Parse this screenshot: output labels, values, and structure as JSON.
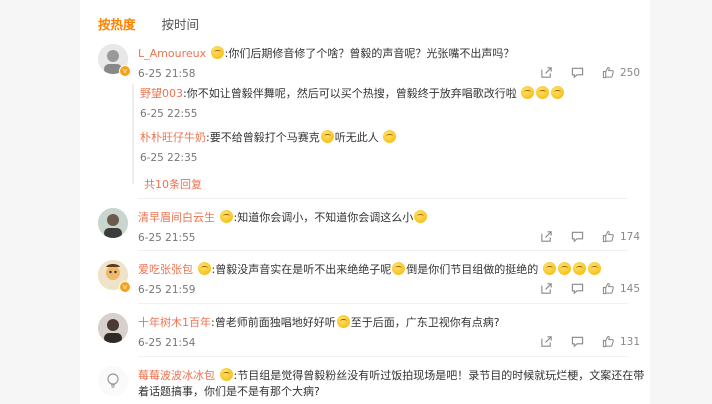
{
  "tabs": [
    {
      "label": "按热度"
    },
    {
      "label": "按时间"
    }
  ],
  "comments": [
    {
      "user": "L_Amoureux",
      "text": ":你们后期修音修了个啥？曾毅的声音呢？光张嘴不出声吗？",
      "time": "6-25 21:58",
      "likes": "250",
      "replies": [
        {
          "user": "野望003",
          "text": ":你不如让曾毅伴舞呢，然后可以买个热搜，曾毅终于放弃唱歌改行啦",
          "time": "6-25 22:55"
        },
        {
          "user": "朴朴旺仔牛奶",
          "text": ":要不给曾毅打个马赛克",
          "text2": "听无此人",
          "time": "6-25 22:35"
        }
      ],
      "more_replies": "共10条回复"
    },
    {
      "user": "清早眉间白云生",
      "text": ":知道你会调小，不知道你会调这么小",
      "time": "6-25 21:55",
      "likes": "174"
    },
    {
      "user": "爱吃张张包",
      "text": ":曾毅没声音实在是听不出来绝绝子呢",
      "text2": "倒是你们节目组做的挺绝的",
      "time": "6-25 21:59",
      "likes": "145"
    },
    {
      "user": "十年树木1百年",
      "text": ":曾老师前面独唱地好好听",
      "text2": "至于后面，广东卫视你有点病?",
      "time": "6-25 21:54",
      "likes": "131"
    },
    {
      "user": "莓莓波波冰冰包",
      "text": ":节目组是觉得曾毅粉丝没有听过饭拍现场是吧！录节目的时候就玩烂梗，文案还在带",
      "text2": "着话题搞事，你们是不是有那个大病?"
    }
  ]
}
